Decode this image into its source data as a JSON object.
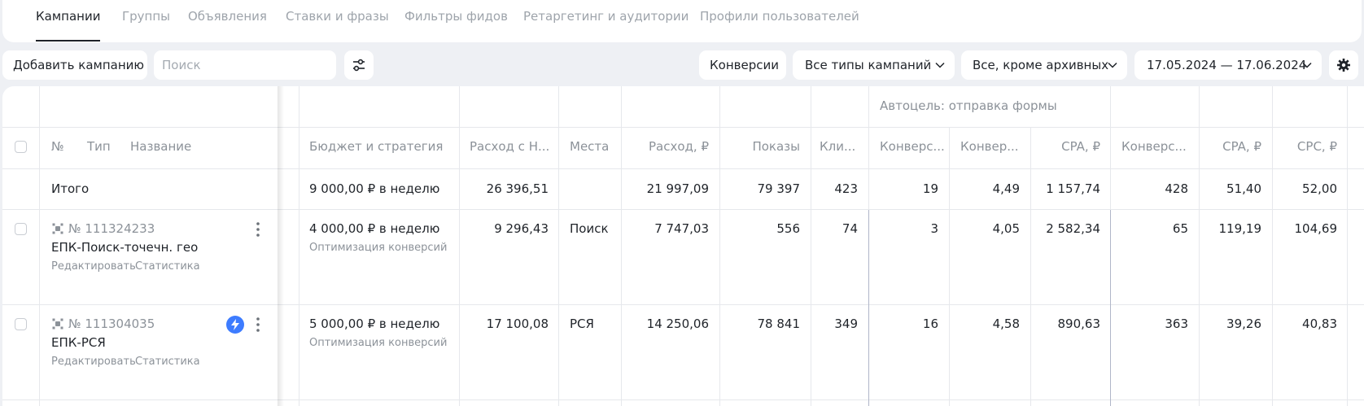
{
  "tabs": [
    {
      "label": "Кампании",
      "active": true
    },
    {
      "label": "Группы",
      "active": false
    },
    {
      "label": "Объявления",
      "active": false
    },
    {
      "label": "Ставки и фразы",
      "active": false
    },
    {
      "label": "Фильтры фидов",
      "active": false
    },
    {
      "label": "Ретаргетинг и аудитории",
      "active": false
    },
    {
      "label": "Профили пользователей",
      "active": false
    }
  ],
  "toolbar": {
    "add_campaign_label": "Добавить кампанию",
    "search_placeholder": "Поиск",
    "search_value": "",
    "filter_icon": "sliders-icon",
    "conversions_label": "Конверсии",
    "campaign_types_label": "Все типы кампаний",
    "status_filter_label": "Все, кроме архивных",
    "date_range_label": "17.05.2024 — 17.06.2024",
    "settings_icon": "gear-icon"
  },
  "table": {
    "group_header": "Автоцель: отправка формы",
    "columns": {
      "number": "№",
      "type": "Тип",
      "name": "Название",
      "budget": "Бюджет и стратегия",
      "spend_vat": "Расход с Н...",
      "places": "Места",
      "spend": "Расход, ₽",
      "impressions": "Показы",
      "clicks": "Кли...",
      "conv_goal": "Конверс...",
      "conv_rate_goal": "Конвер...",
      "cpa_goal": "CPA, ₽",
      "conversions": "Конверс...",
      "cpa": "CPA, ₽",
      "cpc": "CPC, ₽"
    },
    "totals": {
      "label": "Итого",
      "budget": "9 000,00 ₽ в неделю",
      "spend_vat": "26 396,51",
      "places": "",
      "spend": "21 997,09",
      "impressions": "79 397",
      "clicks": "423",
      "conv_goal": "19",
      "conv_rate_goal": "4,49",
      "cpa_goal": "1 157,74",
      "conversions": "428",
      "cpa": "51,40",
      "cpc": "52,00"
    },
    "rows": [
      {
        "number": "№ 111324233",
        "name": "ЕПК-Поиск-точечн. гео",
        "edit_label": "Редактировать",
        "stats_label": "Статистика",
        "has_badge": false,
        "budget": "4 000,00 ₽ в неделю",
        "strategy": "Оптимизация конверсий",
        "spend_vat": "9 296,43",
        "places": "Поиск",
        "spend": "7 747,03",
        "impressions": "556",
        "clicks": "74",
        "conv_goal": "3",
        "conv_rate_goal": "4,05",
        "cpa_goal": "2 582,34",
        "conversions": "65",
        "cpa": "119,19",
        "cpc": "104,69"
      },
      {
        "number": "№ 111304035",
        "name": "ЕПК-РСЯ",
        "edit_label": "Редактировать",
        "stats_label": "Статистика",
        "has_badge": true,
        "budget": "5 000,00 ₽ в неделю",
        "strategy": "Оптимизация конверсий",
        "spend_vat": "17 100,08",
        "places": "РСЯ",
        "spend": "14 250,06",
        "impressions": "78 841",
        "clicks": "349",
        "conv_goal": "16",
        "conv_rate_goal": "4,58",
        "cpa_goal": "890,63",
        "conversions": "363",
        "cpa": "39,26",
        "cpc": "40,83"
      }
    ]
  },
  "colors": {
    "background": "#eef0f4",
    "card": "#ffffff",
    "text": "#1f2329",
    "muted": "#8c9299",
    "accent": "#3d7cff",
    "group_divider": "#b0b6c8"
  }
}
